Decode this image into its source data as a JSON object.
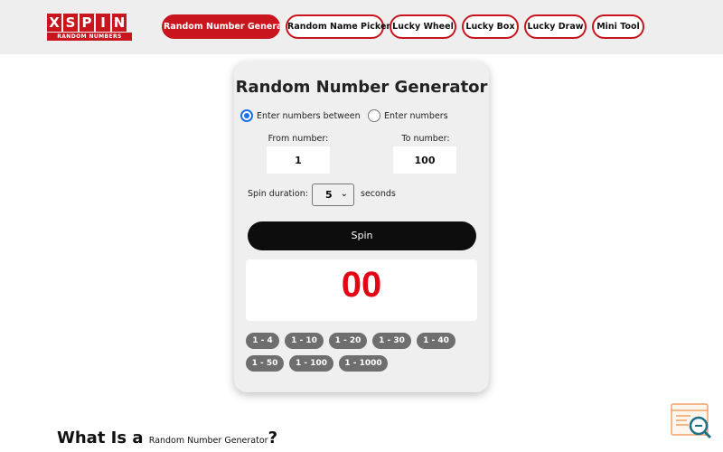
{
  "header": {
    "logo": {
      "top_text": "XSPIN",
      "bottom_text": "RANDOM NUMBERS"
    },
    "nav": [
      {
        "label": "Random Number Generator",
        "active": true
      },
      {
        "label": "Random Name Picker",
        "active": false
      },
      {
        "label": "Lucky Wheel",
        "active": false
      },
      {
        "label": "Lucky Box",
        "active": false
      },
      {
        "label": "Lucky Draw",
        "active": false
      },
      {
        "label": "Mini Tool",
        "active": false
      }
    ]
  },
  "generator": {
    "title": "Random Number Generator",
    "mode_options": [
      {
        "label": "Enter numbers between",
        "checked": true
      },
      {
        "label": "Enter numbers",
        "checked": false
      }
    ],
    "from_label": "From number:",
    "from_value": "1",
    "to_label": "To number:",
    "to_value": "100",
    "duration_label": "Spin duration:",
    "duration_value": "5",
    "duration_unit": "seconds",
    "spin_label": "Spin",
    "result": "00",
    "presets": [
      "1 - 4",
      "1 - 10",
      "1 - 20",
      "1 - 30",
      "1 - 40",
      "1 - 50",
      "1 - 100",
      "1 - 1000"
    ]
  },
  "section": {
    "heading_prefix": "What Is a",
    "heading_inline": "Random Number Generator",
    "heading_suffix": "?"
  },
  "widget": {
    "icon": "search-help-icon"
  },
  "colors": {
    "brand_red": "#c9151e",
    "result_red": "#e30613",
    "accent_blue": "#1a73e8",
    "preset_gray": "#6e6e6e"
  }
}
